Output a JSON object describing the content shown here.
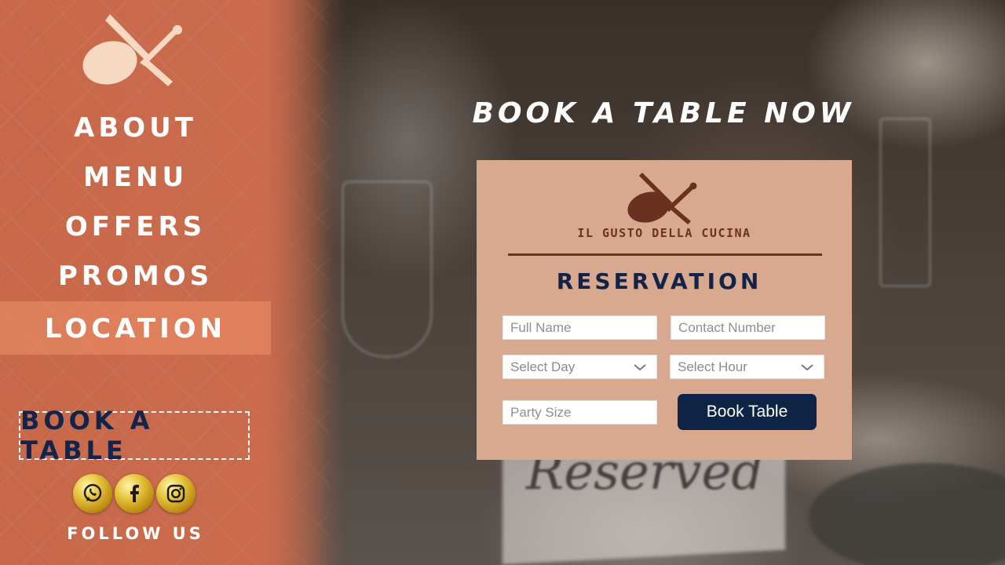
{
  "nav": {
    "items": [
      {
        "label": "ABOUT"
      },
      {
        "label": "MENU"
      },
      {
        "label": "OFFERS"
      },
      {
        "label": "PROMOS"
      },
      {
        "label": "LOCATION"
      }
    ],
    "active": "LOCATION",
    "book_label": "BOOK A TABLE",
    "follow_label": "FOLLOW US",
    "socials": [
      "whatsapp-icon",
      "facebook-icon",
      "instagram-icon"
    ]
  },
  "headline": "BOOK A TABLE NOW",
  "reservation": {
    "brand": "IL GUSTO DELLA CUCINA",
    "title": "RESERVATION",
    "full_name_placeholder": "Full Name",
    "contact_placeholder": "Contact Number",
    "day_value": "Select Day",
    "hour_value": "Select Hour",
    "party_placeholder": "Party Size",
    "submit_label": "Book Table"
  },
  "background": {
    "sign_text": "Reserved"
  },
  "colors": {
    "sidebar": "#c96b4c",
    "card": "#d9a98f",
    "navy": "#0e2446",
    "brand_brown": "#6b3120",
    "logo_light": "#f5d9c0"
  }
}
